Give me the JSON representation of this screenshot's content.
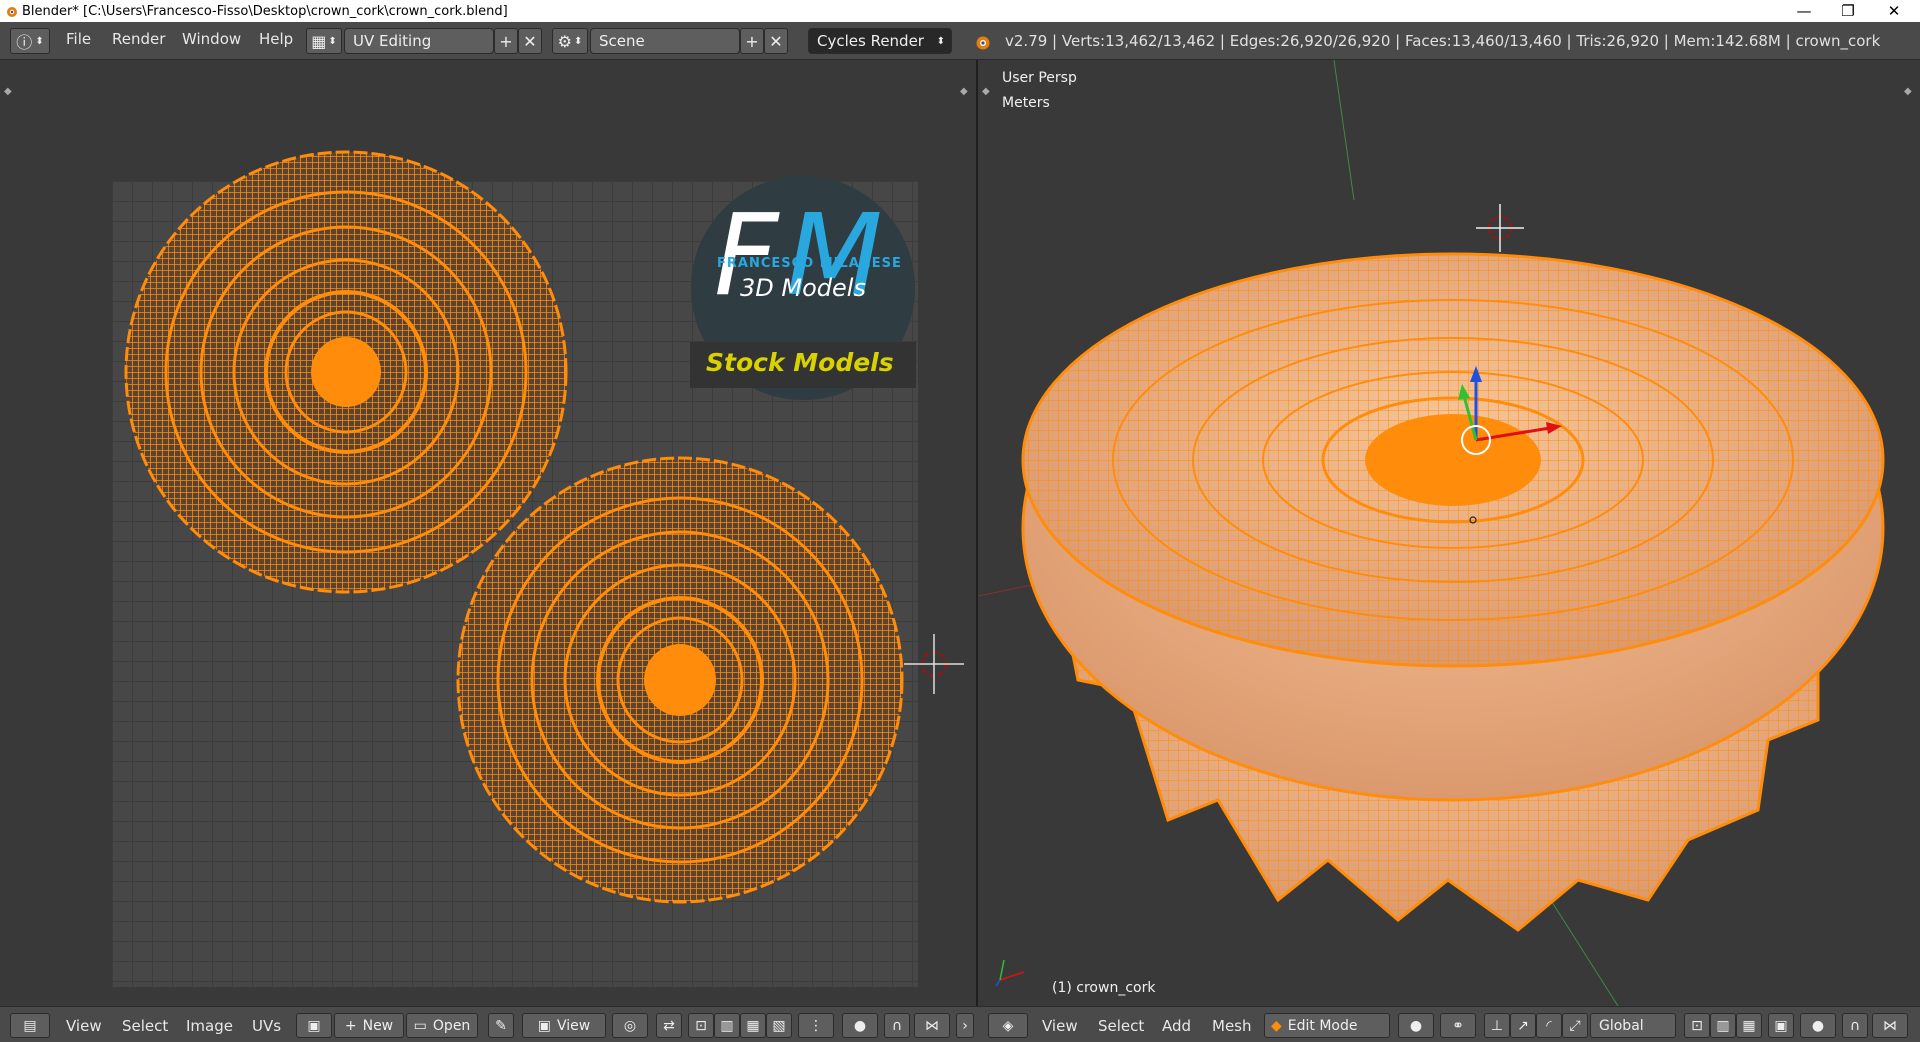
{
  "window": {
    "title": "Blender* [C:\\Users\\Francesco-Fisso\\Desktop\\crown_cork\\crown_cork.blend]",
    "minimize": "—",
    "restore": "❐",
    "close": "✕"
  },
  "topbar": {
    "menus": [
      "File",
      "Render",
      "Window",
      "Help"
    ],
    "layout_name": "UV Editing",
    "scene_name": "Scene",
    "render_engine": "Cycles Render",
    "stats": "v2.79 | Verts:13,462/13,462 | Edges:26,920/26,920 | Faces:13,460/13,460 | Tris:26,920 | Mem:142.68M | crown_cork"
  },
  "uv_editor": {
    "watermark": {
      "initial_f": "F",
      "initial_m": "M",
      "brand": "FRANCESCO MILANESE",
      "subtitle": "3D Models",
      "banner": "Stock Models"
    },
    "bottombar": {
      "menus": [
        "View",
        "Select",
        "Image",
        "UVs"
      ],
      "new_label": "New",
      "open_label": "Open",
      "view_label": "View"
    }
  },
  "viewport": {
    "persp_label": "User Persp",
    "units_label": "Meters",
    "object_label": "(1) crown_cork",
    "bottombar": {
      "menus": [
        "View",
        "Select",
        "Add",
        "Mesh"
      ],
      "mode": "Edit Mode",
      "orientation": "Global"
    }
  },
  "colors": {
    "accent_orange": "#ff8c0a",
    "mesh_fill": "#f0b47a",
    "brand_blue": "#29a8e0",
    "banner_yellow": "#d8d200"
  }
}
